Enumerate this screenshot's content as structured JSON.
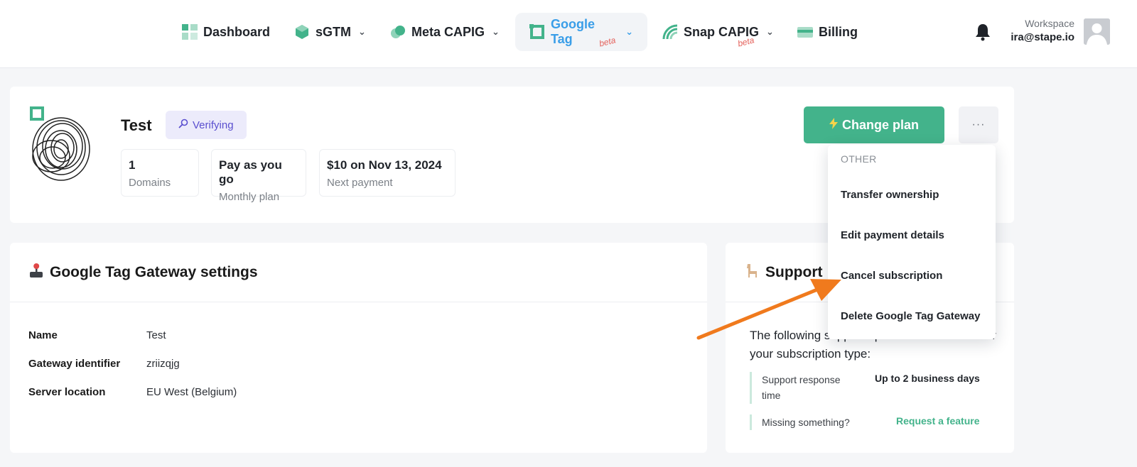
{
  "nav": {
    "items": [
      {
        "label": "Dashboard",
        "icon": "dashboard-icon",
        "chevron": ""
      },
      {
        "label": "sGTM",
        "icon": "cube-icon",
        "chevron": "⌄"
      },
      {
        "label": "Meta CAPIG",
        "icon": "meta-icon",
        "chevron": "⌄"
      },
      {
        "label": "Google Tag",
        "icon": "google-tag-icon",
        "chevron": "⌄",
        "beta": "beta"
      },
      {
        "label": "Snap CAPIG",
        "icon": "snap-icon",
        "chevron": "⌄",
        "beta": "beta"
      },
      {
        "label": "Billing",
        "icon": "billing-icon",
        "chevron": ""
      }
    ],
    "active_index": 3,
    "workspace_label": "Workspace",
    "workspace_email": "ira@stape.io"
  },
  "header": {
    "title": "Test",
    "status_badge": "Verifying",
    "stats": [
      {
        "value": "1",
        "label": "Domains"
      },
      {
        "value": "Pay as you go",
        "label": "Monthly plan"
      },
      {
        "value": "$10 on Nov 13, 2024",
        "label": "Next payment"
      }
    ],
    "change_plan_label": "Change plan",
    "more_label": "···"
  },
  "dropdown": {
    "section": "OTHER",
    "items": [
      "Transfer ownership",
      "Edit payment details",
      "Cancel subscription",
      "Delete Google Tag Gateway"
    ]
  },
  "settings": {
    "title": "Google Tag Gateway settings",
    "rows": [
      {
        "key": "Name",
        "value": "Test"
      },
      {
        "key": "Gateway identifier",
        "value": "zriizqjg"
      },
      {
        "key": "Server location",
        "value": "EU West (Belgium)"
      }
    ]
  },
  "support": {
    "title": "Support",
    "intro": "The following support options are available for your subscription type:",
    "response_label": "Support response time",
    "response_value": "Up to 2 business days",
    "missing_label": "Missing something?",
    "missing_link": "Request a feature"
  },
  "colors": {
    "accent_green": "#43b38b",
    "active_blue": "#3a9ee8",
    "badge_purple": "#5a4fcf",
    "arrow_orange": "#f07a1d"
  }
}
